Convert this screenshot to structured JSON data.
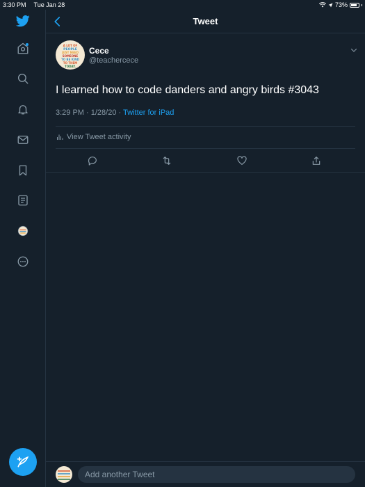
{
  "status_bar": {
    "time": "3:30 PM",
    "date": "Tue Jan 28",
    "battery": "73%"
  },
  "sidebar": {
    "items": [
      {
        "name": "home-icon",
        "active_dot": true
      },
      {
        "name": "search-icon"
      },
      {
        "name": "notifications-icon"
      },
      {
        "name": "messages-icon"
      },
      {
        "name": "bookmarks-icon"
      },
      {
        "name": "lists-icon"
      },
      {
        "name": "profile-avatar"
      },
      {
        "name": "more-icon"
      }
    ],
    "compose_icon": "compose-tweet-icon"
  },
  "header": {
    "title": "Tweet"
  },
  "tweet": {
    "display_name": "Cece",
    "handle": "@teachercece",
    "text": "I learned how to code danders and angry birds #3043",
    "time": "3:29 PM",
    "date": "1/28/20",
    "separator": " · ",
    "source": "Twitter for iPad",
    "activity_label": "View Tweet activity",
    "avatar_text": [
      "A LOT OF",
      "PEOPLE",
      "JUST NEED",
      "SOMEONE",
      "TO BE KIND",
      "TO THEM",
      "TODAY."
    ]
  },
  "reply": {
    "placeholder": "Add another Tweet"
  },
  "colors": {
    "background": "#15202b",
    "border": "#253341",
    "accent": "#1da1f2",
    "secondary_text": "#8899a6"
  }
}
